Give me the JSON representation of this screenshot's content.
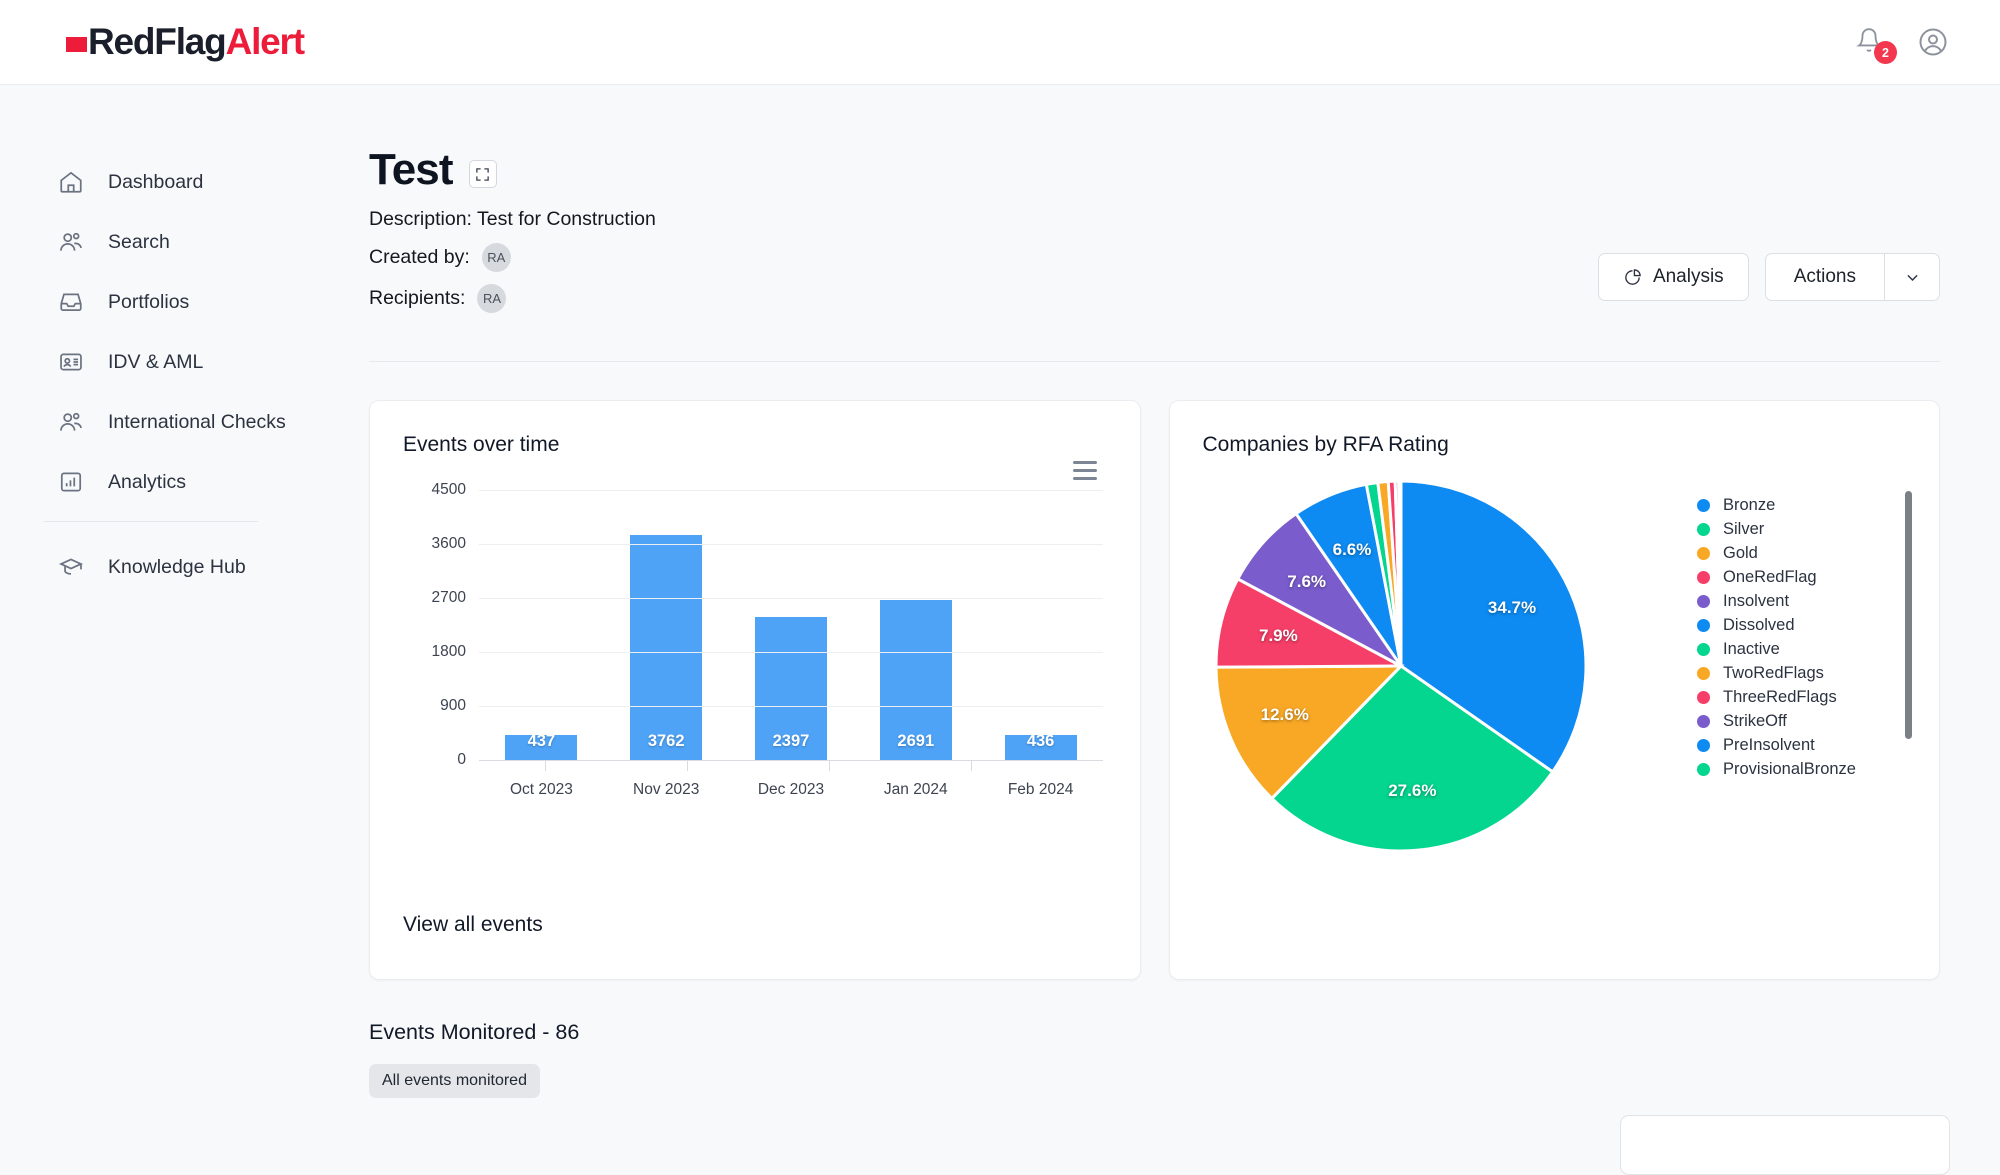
{
  "brand": {
    "square": "red-square",
    "name_dark": "RedFlag",
    "name_red": "Alert",
    "accent": "#ed1c3a"
  },
  "topbar": {
    "notifications_count": "2",
    "bell_icon": "bell-icon",
    "avatar_icon": "user-circle-icon"
  },
  "sidebar": {
    "items": [
      {
        "label": "Dashboard",
        "icon": "home-icon"
      },
      {
        "label": "Search",
        "icon": "people-icon"
      },
      {
        "label": "Portfolios",
        "icon": "inbox-icon"
      },
      {
        "label": "IDV & AML",
        "icon": "id-card-icon"
      },
      {
        "label": "International Checks",
        "icon": "people-icon"
      },
      {
        "label": "Analytics",
        "icon": "bar-chart-icon"
      }
    ],
    "footer_items": [
      {
        "label": "Knowledge Hub",
        "icon": "graduation-cap-icon"
      }
    ]
  },
  "page": {
    "title": "Test",
    "expand_icon": "expand-icon",
    "description": "Description: Test for Construction",
    "created_by_label": "Created by:",
    "created_by_initials": "RA",
    "recipients_label": "Recipients:",
    "recipients_initials": "RA"
  },
  "actions": {
    "analysis_label": "Analysis",
    "analysis_icon": "pie-chart-icon",
    "actions_label": "Actions",
    "caret_icon": "chevron-down-icon"
  },
  "events_card": {
    "title": "Events over time",
    "menu_icon": "hamburger-menu-icon",
    "view_all_label": "View all events"
  },
  "pie_card": {
    "title": "Companies by RFA Rating"
  },
  "bottom": {
    "monitored_title": "Events Monitored - 86",
    "tag_label": "All events monitored"
  },
  "chart_data": [
    {
      "type": "bar",
      "title": "Events over time",
      "xlabel": "",
      "ylabel": "",
      "categories": [
        "Oct 2023",
        "Nov 2023",
        "Dec 2023",
        "Jan 2024",
        "Feb 2024"
      ],
      "values": [
        437,
        3762,
        2397,
        2691,
        436
      ],
      "yticks": [
        0,
        900,
        1800,
        2700,
        3600,
        4500
      ],
      "ylim": [
        0,
        4500
      ],
      "grid": true,
      "legend": "none",
      "bar_color": "#4ea3f7",
      "data_labels": [
        "437",
        "3762",
        "2397",
        "2691",
        "436"
      ]
    },
    {
      "type": "pie",
      "title": "Companies by RFA Rating",
      "legend": "right",
      "labels": [
        "Bronze",
        "Silver",
        "Gold",
        "OneRedFlag",
        "Insolvent",
        "Dissolved",
        "Inactive",
        "TwoRedFlags",
        "ThreeRedFlags",
        "StrikeOff",
        "PreInsolvent",
        "ProvisionalBronze"
      ],
      "values": [
        34.7,
        27.6,
        12.6,
        7.9,
        7.6,
        6.6,
        1.0,
        0.9,
        0.6,
        0.3,
        0.15,
        0.05
      ],
      "shown_labels": [
        "34.7%",
        "27.6%",
        "12.6%",
        "7.9%",
        "7.6%",
        "6.6%"
      ],
      "colors": [
        "#0d8bf2",
        "#04d58f",
        "#f9a825",
        "#f63f68",
        "#7a5ccc",
        "#0d8bf2",
        "#04d58f",
        "#f9a825",
        "#f63f68",
        "#7a5ccc",
        "#0d8bf2",
        "#04d58f"
      ]
    }
  ]
}
